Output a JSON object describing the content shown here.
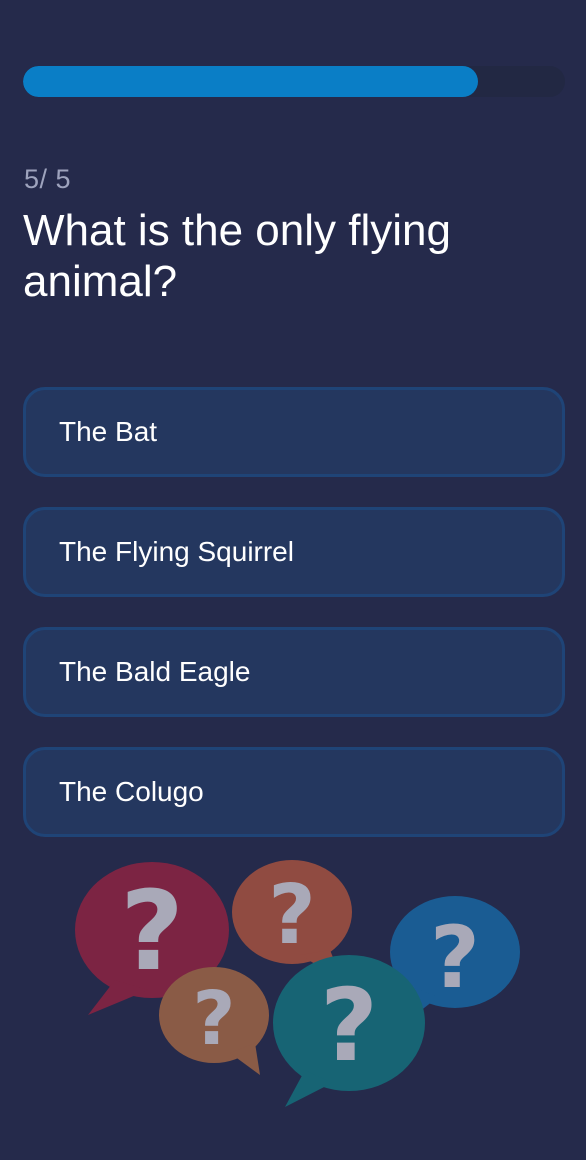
{
  "progress": {
    "value": 0.84
  },
  "counter": {
    "current": "5",
    "separator": "/ ",
    "total": "5"
  },
  "question": {
    "text": "What is the only flying animal?"
  },
  "options": [
    {
      "label": "The Bat"
    },
    {
      "label": "The Flying Squirrel"
    },
    {
      "label": "The Bald Eagle"
    },
    {
      "label": "The Colugo"
    }
  ],
  "illustration": {
    "icon": "question-bubbles-icon",
    "bubble_colors": [
      "#7c2443",
      "#904b41",
      "#8a5b46",
      "#176474",
      "#1a5c93"
    ],
    "mark_color": "#a9a9b8"
  },
  "colors": {
    "background": "#252a4b",
    "accent": "#0a7ec6",
    "option_fill": "#24375f",
    "option_border": "#1f4477"
  }
}
